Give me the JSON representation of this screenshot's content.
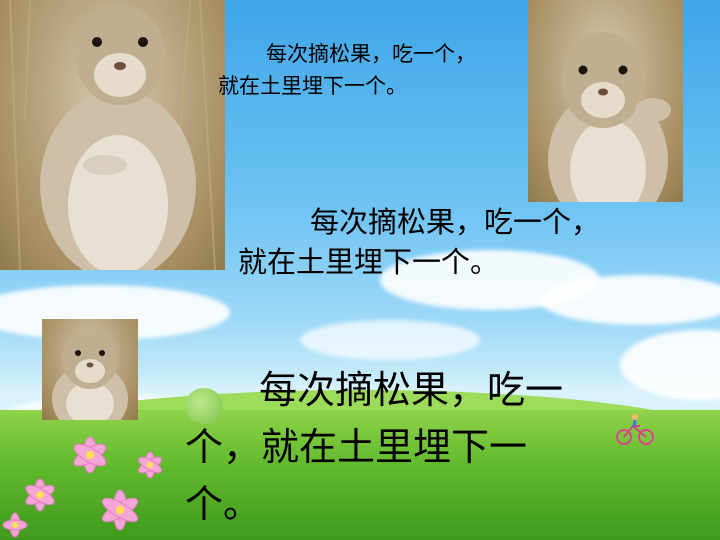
{
  "slide": {
    "text_small": {
      "line1": "每次摘松果，吃一个，",
      "line2": "就在土里埋下一个。"
    },
    "text_medium": {
      "line1": "每次摘松果，吃一个，",
      "line2": "就在土里埋下一个。"
    },
    "text_large": {
      "line1": "每次摘松果，吃一",
      "line2": "个，就在土里埋下一",
      "line3": "个。"
    }
  },
  "colors": {
    "sky_top": "#3fa6e8",
    "grass": "#5fb82c",
    "text": "#000000"
  },
  "icons": [
    "squirrel-photo-large",
    "squirrel-photo-right",
    "squirrel-photo-small",
    "flower-icon",
    "bicycle-icon"
  ]
}
